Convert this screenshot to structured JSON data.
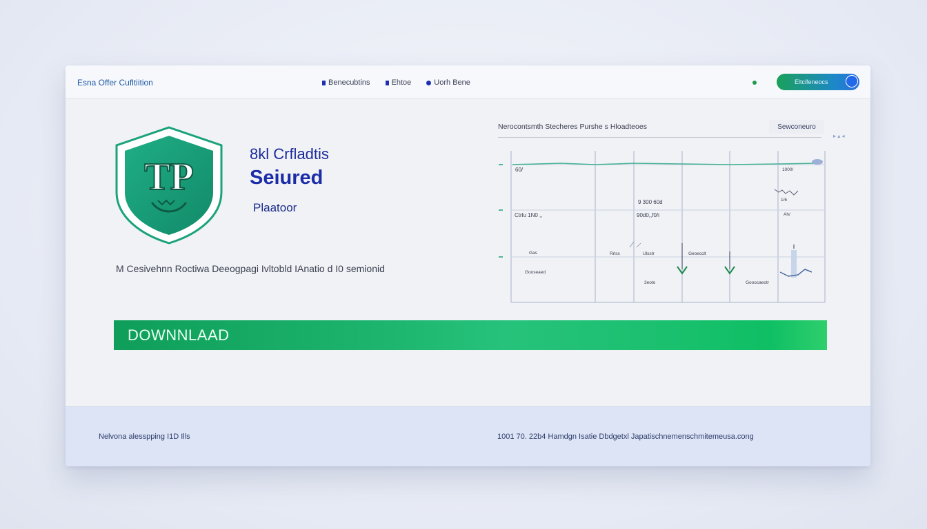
{
  "topbar": {
    "brand": "Esna Offer Cufltiition",
    "nav": [
      {
        "label": "Benecubtins",
        "marker": "square"
      },
      {
        "label": "Ehtoe",
        "marker": "square"
      },
      {
        "label": "Uorh Bene",
        "marker": "dot"
      }
    ],
    "account_button": "Eltcifeneocs"
  },
  "hero": {
    "line1": "8kl Crfladtis",
    "line2": "Seiured",
    "line3": "Plaatoor",
    "logo_text": "TP"
  },
  "subtitle": "M Cesivehnn Roctiwa Deeogpagi Ivltobld IAnatio d I0 semionid",
  "panel": {
    "title": "Nerocontsmth Stecheres Purshe s Hloadteoes",
    "tab": "Sewconeuro",
    "deco": "▸ ▴ ◂",
    "labels": [
      "60/",
      "Ctrlu 1N0 ,,",
      "9 300 60d",
      "90d0,,f0/i",
      "Gas",
      "Rrlss",
      "Ulsstr",
      "Geoecclt",
      "Gooseaed",
      "1000/",
      "Ah/",
      "3eoto",
      "Gooocaeotr",
      "1/6"
    ]
  },
  "download": {
    "label": "DOWNNLAAD"
  },
  "footer": {
    "left": "Nelvona alesspping I1D Ills",
    "right": "1001 70. 22b4 Hamdgn Isatie Dbdgetxl Japatischnemenschmitemeusa.cong"
  },
  "colors": {
    "brand_blue": "#1a2ca8",
    "accent_green": "#1cb36c",
    "shield_teal": "#1aa27a",
    "account_button": "#1d88c8"
  },
  "icons": {
    "logo": "shield-logo-icon",
    "status": "status-dot-icon",
    "toggle": "toggle-knob-icon"
  }
}
